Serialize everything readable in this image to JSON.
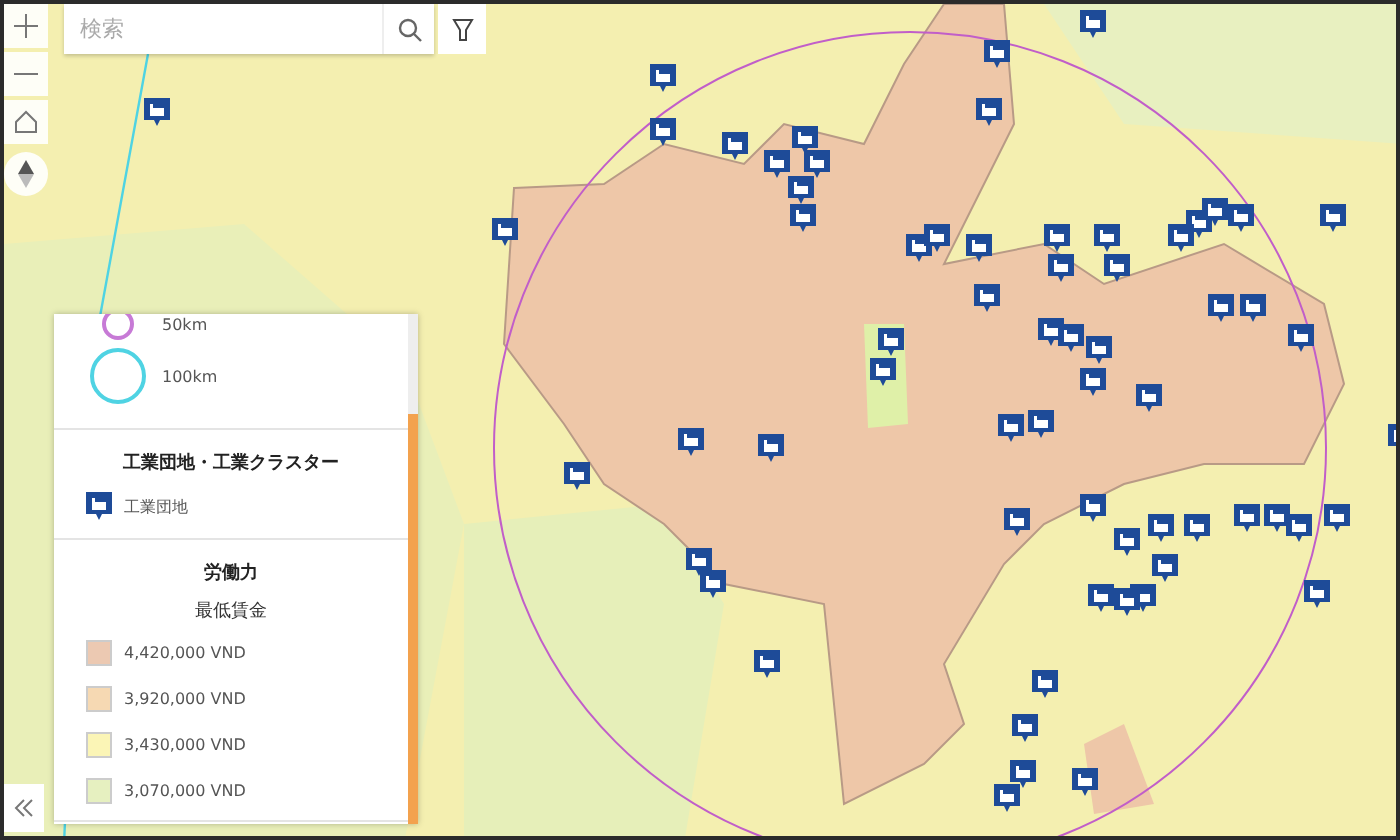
{
  "search": {
    "placeholder": "検索"
  },
  "legend": {
    "distance_rings": [
      {
        "label": "50km",
        "color": "#c77ad6"
      },
      {
        "label": "100km",
        "color": "#4fd3e3"
      }
    ],
    "sections": [
      {
        "kind": "icons",
        "title": "工業団地・工業クラスター",
        "items": [
          {
            "label": "工業団地"
          }
        ]
      },
      {
        "kind": "swatches",
        "title": "労働力",
        "subtitle": "最低賃金",
        "items": [
          {
            "label": "4,420,000 VND",
            "color": "#ecc9b2"
          },
          {
            "label": "3,920,000 VND",
            "color": "#f6d9b3"
          },
          {
            "label": "3,430,000 VND",
            "color": "#fbf5b6"
          },
          {
            "label": "3,070,000 VND",
            "color": "#e6f0c0"
          }
        ]
      }
    ]
  }
}
